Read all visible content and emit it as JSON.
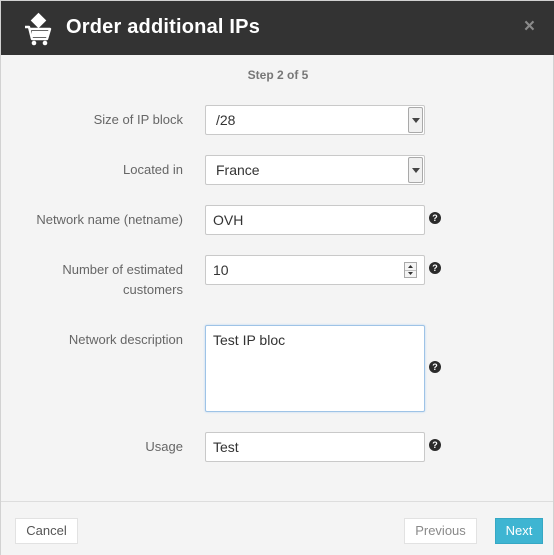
{
  "header": {
    "title": "Order additional IPs",
    "close_label": "×"
  },
  "step": {
    "label": "Step 2 of 5"
  },
  "form": {
    "ip_block_size": {
      "label": "Size of IP block",
      "value": "/28"
    },
    "location": {
      "label": "Located in",
      "value": "France"
    },
    "netname": {
      "label": "Network name (netname)",
      "value": "OVH"
    },
    "customers": {
      "label_line1": "Number of estimated",
      "label_line2": "customers",
      "value": "10"
    },
    "description": {
      "label": "Network description",
      "value": "Test IP bloc"
    },
    "usage": {
      "label": "Usage",
      "value": "Test"
    }
  },
  "help_icon": {
    "glyph": "?"
  },
  "footer": {
    "cancel_label": "Cancel",
    "previous_label": "Previous",
    "next_label": "Next"
  }
}
